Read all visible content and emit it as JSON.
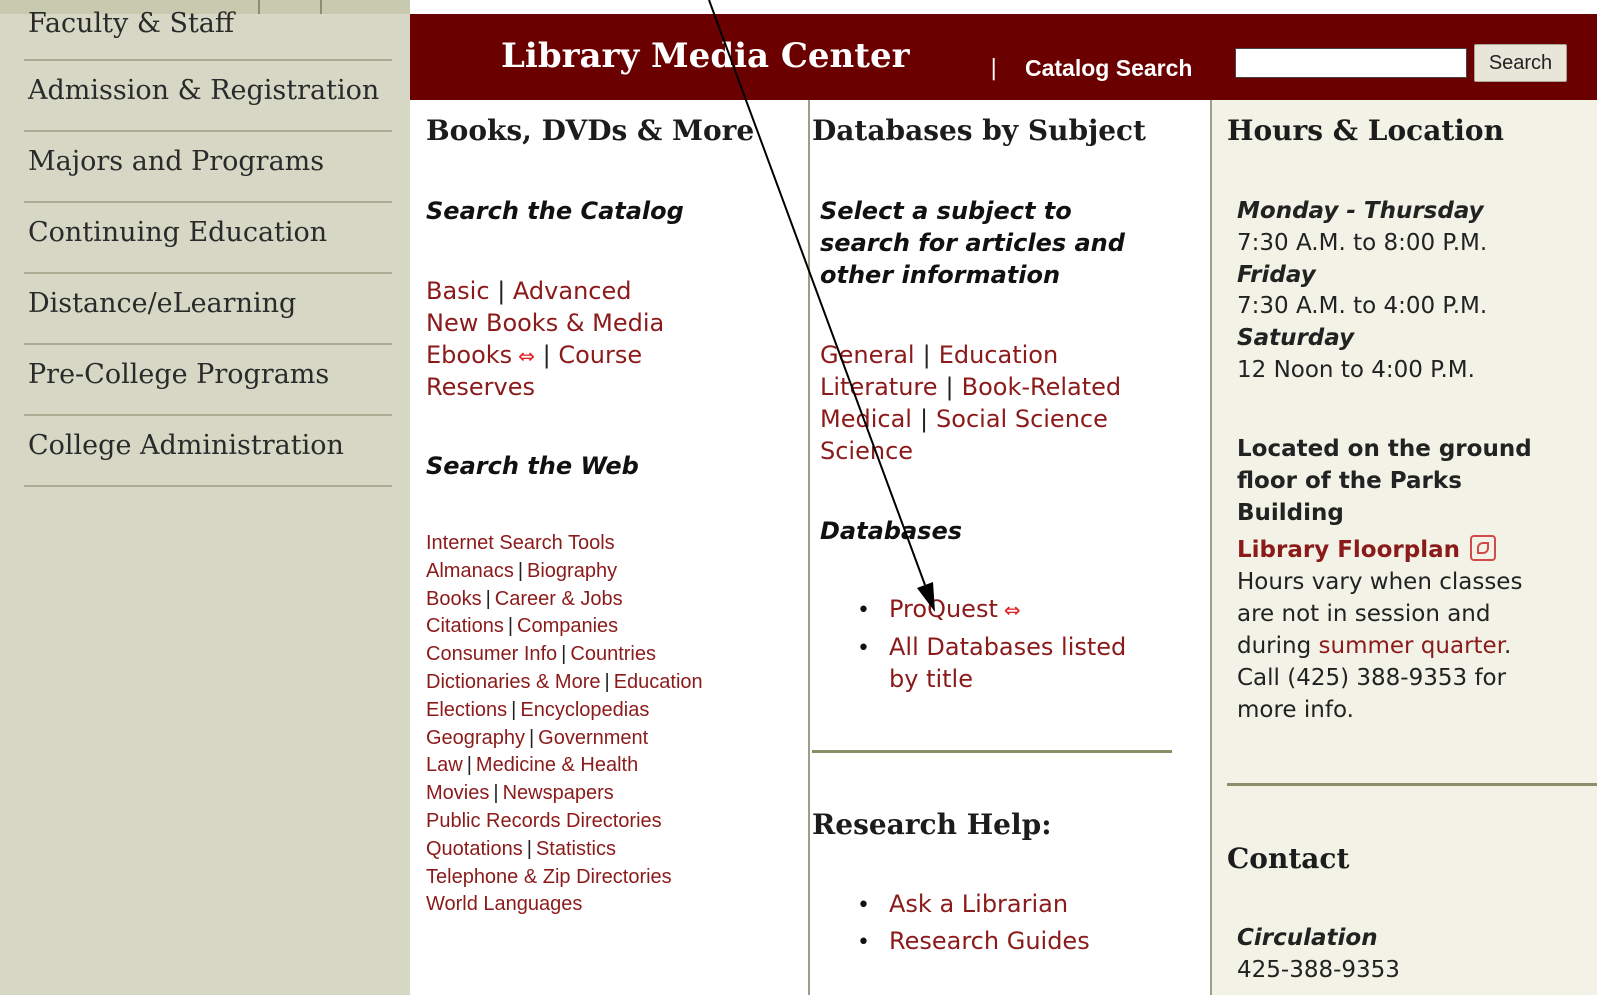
{
  "sidebar": {
    "items": [
      {
        "label": "Faculty & Staff"
      },
      {
        "label": "Admission & Registration"
      },
      {
        "label": "Majors and Programs"
      },
      {
        "label": "Continuing Education"
      },
      {
        "label": "Distance/eLearning"
      },
      {
        "label": "Pre-College Programs"
      },
      {
        "label": "College Administration"
      }
    ]
  },
  "header": {
    "title": "Library Media Center",
    "separator": "|",
    "catalog_search": "Catalog Search",
    "search_value": "",
    "search_button": "Search"
  },
  "books": {
    "heading": "Books, DVDs & More",
    "catalog_heading": "Search the Catalog",
    "basic": "Basic",
    "advanced": "Advanced",
    "new_books": "New Books & Media",
    "ebooks": "Ebooks",
    "course": "Course",
    "reserves": "Reserves",
    "pipe": "|",
    "web_heading": "Search the Web",
    "web_links": [
      [
        "Internet Search Tools"
      ],
      [
        "Almanacs",
        "Biography"
      ],
      [
        "Books",
        "Career & Jobs"
      ],
      [
        "Citations",
        "Companies"
      ],
      [
        "Consumer Info",
        "Countries"
      ],
      [
        "Dictionaries & More",
        "Education"
      ],
      [
        "Elections",
        "Encyclopedias"
      ],
      [
        "Geography",
        "Government"
      ],
      [
        "Law",
        "Medicine & Health"
      ],
      [
        "Movies",
        "Newspapers"
      ],
      [
        "Public Records Directories"
      ],
      [
        "Quotations",
        "Statistics"
      ],
      [
        "Telephone & Zip Directories"
      ],
      [
        "World Languages"
      ]
    ]
  },
  "databases": {
    "heading": "Databases by Subject",
    "intro_lines": [
      "Select a subject to",
      "search for articles and",
      "other information"
    ],
    "subjects": [
      [
        "General",
        "Education"
      ],
      [
        "Literature",
        "Book-Related"
      ],
      [
        "Medical",
        "Social Science"
      ],
      [
        "Science"
      ]
    ],
    "db_heading": "Databases",
    "proquest": "ProQuest",
    "all_db_line1": "All Databases listed",
    "all_db_line2": "by title",
    "research_heading": "Research Help:",
    "ask": "Ask a Librarian",
    "guides": "Research Guides"
  },
  "hours": {
    "heading": "Hours & Location",
    "mon_thu": "Monday - Thursday",
    "mon_thu_time": "7:30 A.M. to 8:00 P.M.",
    "fri": "Friday",
    "fri_time": "7:30 A.M. to 4:00 P.M.",
    "sat": "Saturday",
    "sat_time": "12 Noon to 4:00 P.M.",
    "location_lines": [
      "Located on the ground",
      "floor of the Parks",
      "Building"
    ],
    "floorplan": "Library Floorplan",
    "note1": "Hours vary when classes",
    "note2": "are not in session and",
    "note3_pre": "during ",
    "note3_link": "summer quarter",
    "note3_post": ".",
    "note4": "Call (425) 388-9353 for",
    "note5": "more info.",
    "contact_heading": "Contact",
    "circulation": "Circulation",
    "circulation_phone": "425-388-9353"
  },
  "colors": {
    "header_bg": "#6b0000",
    "link": "#8b1a1a",
    "sidebar_bg": "#d6d8c5",
    "hours_bg": "#f2f3e6"
  },
  "icons": [
    "external-link-icon",
    "pdf-icon",
    "annotation-arrow"
  ]
}
